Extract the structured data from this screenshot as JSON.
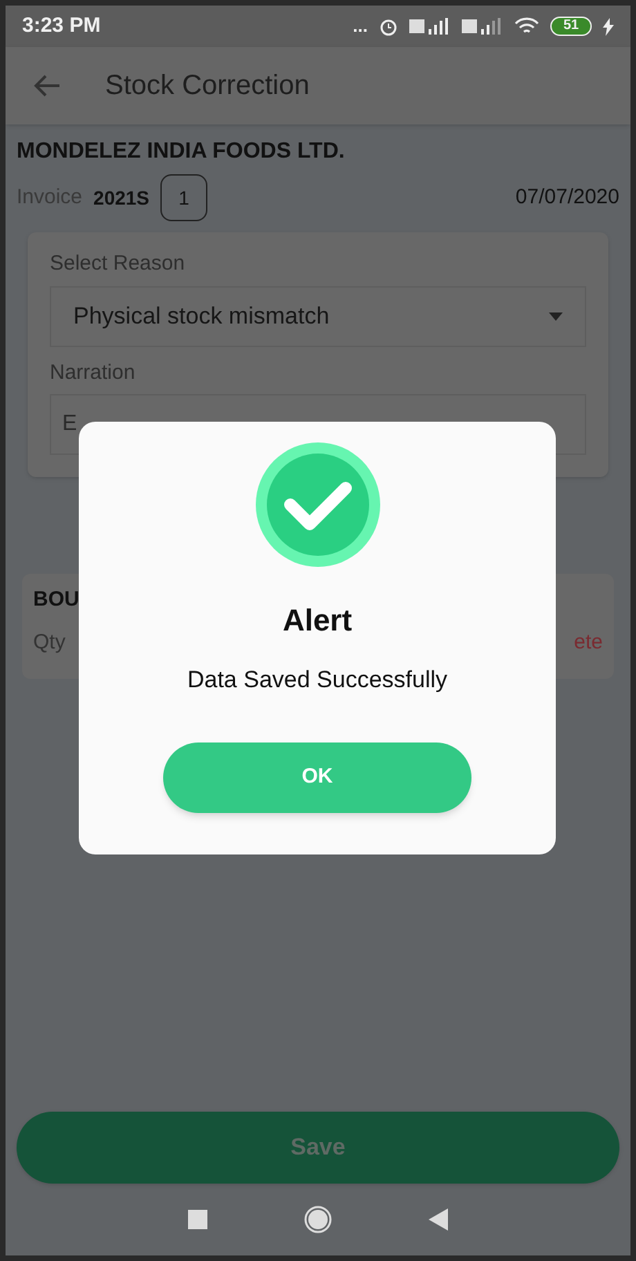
{
  "status_bar": {
    "time": "3:23 PM",
    "more": "...",
    "battery": "51"
  },
  "header": {
    "title": "Stock Correction"
  },
  "company": "MONDELEZ INDIA FOODS LTD.",
  "invoice": {
    "label": "Invoice",
    "number": "2021S",
    "count": "1",
    "date": "07/07/2020"
  },
  "form": {
    "reason_label": "Select Reason",
    "reason_value": "Physical stock mismatch",
    "narration_label": "Narration",
    "narration_placeholder": "E"
  },
  "item_card": {
    "name": "BOU",
    "qty_label": "Qty",
    "action": "ete"
  },
  "dialog": {
    "title": "Alert",
    "message": "Data Saved Successfully",
    "button": "OK"
  },
  "save_button": "Save"
}
